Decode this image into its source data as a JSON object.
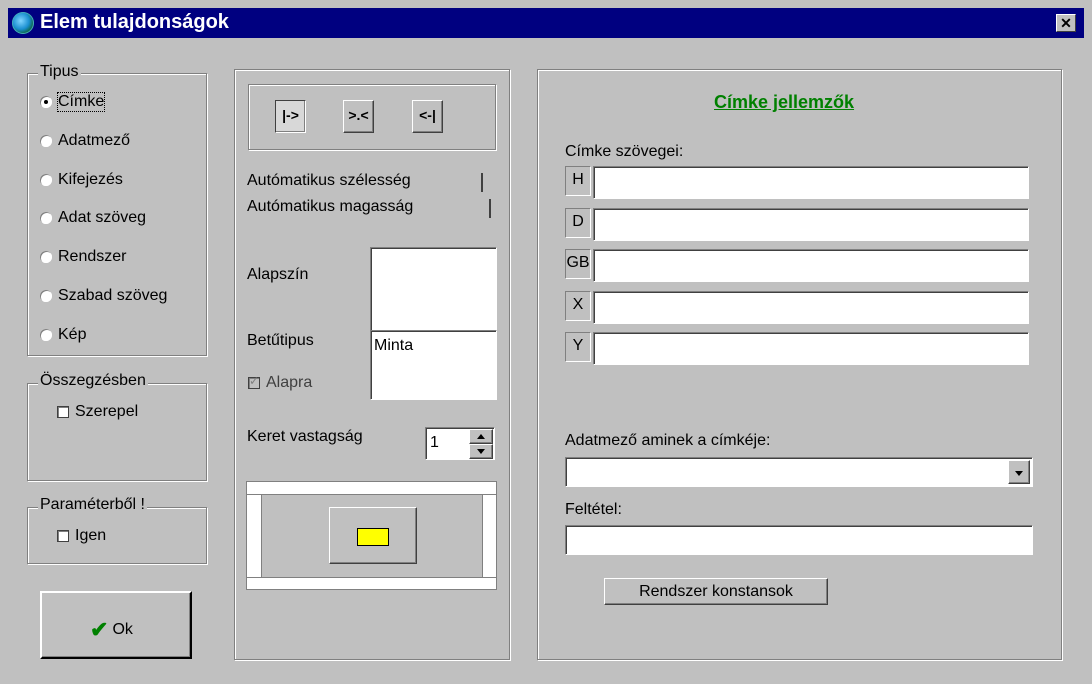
{
  "window": {
    "title": "Elem tulajdonságok",
    "close_glyph": "✕",
    "icon": "globe-icon"
  },
  "tipus": {
    "legend": "Tipus",
    "options": [
      "Címke",
      "Adatmező",
      "Kifejezés",
      "Adat szöveg",
      "Rendszer",
      "Szabad szöveg",
      "Kép"
    ],
    "selected": "Címke"
  },
  "osszegzes": {
    "legend": "Összegzésben",
    "checkbox_label": "Szerepel",
    "checked": false
  },
  "parameter": {
    "legend": "Paraméterből !",
    "checkbox_label": "Igen",
    "checked": false
  },
  "ok_button": {
    "label": "Ok",
    "icon": "checkmark-icon"
  },
  "align": {
    "left": "|->",
    "center": ">.<",
    "right": "<-|"
  },
  "auto_width": {
    "label": "Autómatikus szélesség",
    "checked": false
  },
  "auto_height": {
    "label": "Autómatikus magasság",
    "checked": false
  },
  "alapszin": {
    "label": "Alapszín"
  },
  "betutipus": {
    "label": "Betűtipus",
    "sample": "Minta"
  },
  "alapra": {
    "label": "Alapra",
    "checked": true,
    "disabled": true
  },
  "keret": {
    "label": "Keret vastagság",
    "value": "1"
  },
  "preview": {
    "color": "#ffff00"
  },
  "right": {
    "heading": "Címke jellemzők",
    "texts_label": "Címke szövegei:",
    "langs": [
      "H",
      "D",
      "GB",
      "X",
      "Y"
    ],
    "data_field_label": "Adatmező aminek a címkéje:",
    "data_field_value": "",
    "condition_label": "Feltétel:",
    "condition_value": "",
    "system_constants_label": "Rendszer konstansok"
  },
  "colors": {
    "titlebar": "#000080",
    "heading": "#008000",
    "face": "#c0c0c0"
  }
}
